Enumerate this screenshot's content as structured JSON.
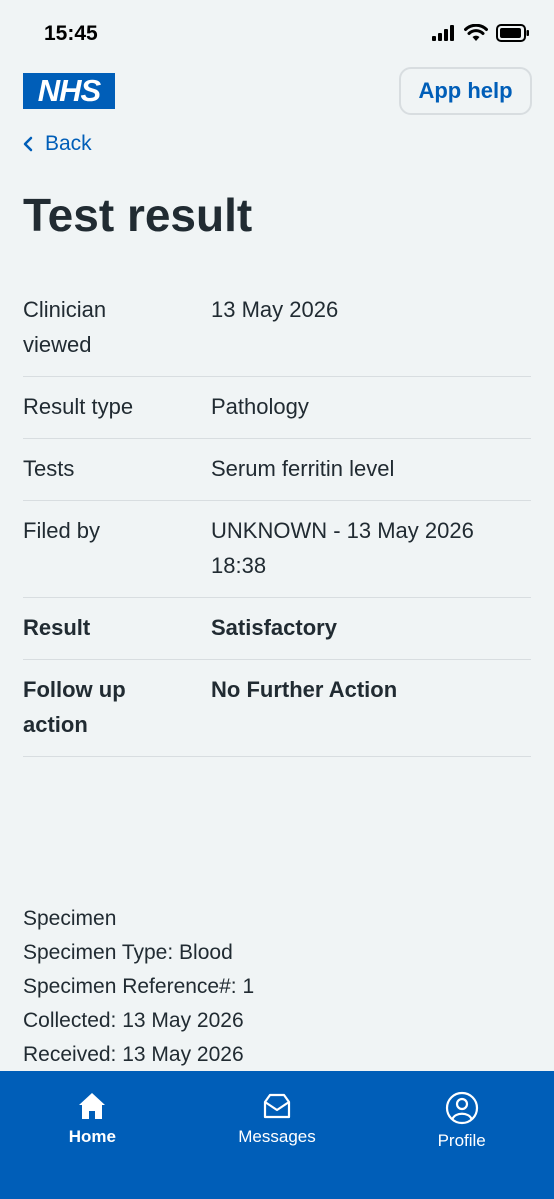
{
  "status_bar": {
    "time": "15:45"
  },
  "header": {
    "logo_text": "NHS",
    "app_help_label": "App help"
  },
  "back_label": "Back",
  "page_title": "Test result",
  "rows": [
    {
      "label": "Clinician viewed",
      "value": "13 May 2026",
      "bold": false
    },
    {
      "label": "Result type",
      "value": "Pathology",
      "bold": false
    },
    {
      "label": "Tests",
      "value": "Serum ferritin level",
      "bold": false
    },
    {
      "label": "Filed by",
      "value": "UNKNOWN - 13 May 2026 18:38",
      "bold": false
    },
    {
      "label": "Result",
      "value": "Satisfactory",
      "bold": true
    },
    {
      "label": "Follow up action",
      "value": "No Further Action",
      "bold": true
    }
  ],
  "specimen": {
    "heading": "Specimen",
    "type": "Specimen Type: Blood",
    "reference": "Specimen Reference#: 1",
    "collected": "Collected: 13 May 2026",
    "received": "Received: 13 May 2026"
  },
  "tabs": [
    {
      "label": "Home",
      "icon": "home-icon",
      "active": true
    },
    {
      "label": "Messages",
      "icon": "envelope-icon",
      "active": false
    },
    {
      "label": "Profile",
      "icon": "profile-icon",
      "active": false
    }
  ],
  "colors": {
    "brand": "#005eb8",
    "background": "#f0f4f5",
    "text": "#212b32"
  }
}
